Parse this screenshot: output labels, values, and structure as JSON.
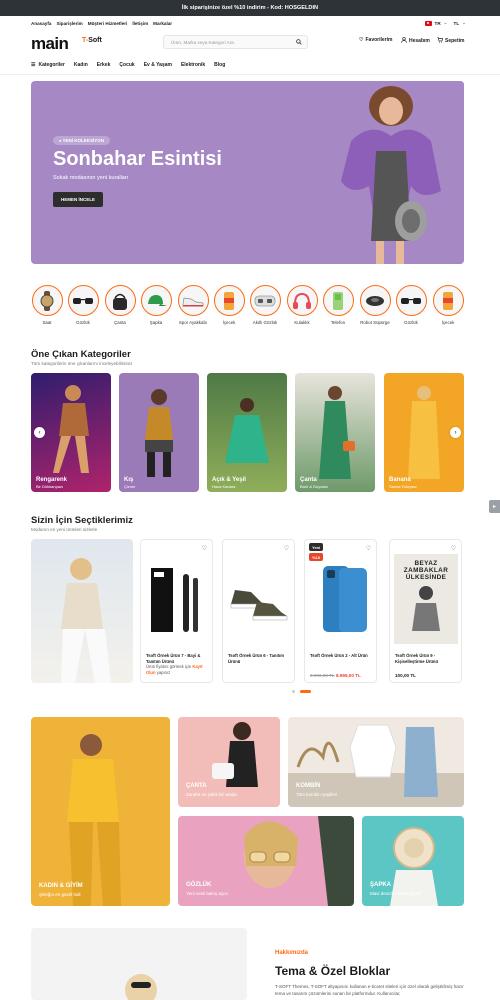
{
  "announcement": "İlk siparişinize özel %10 indirim - Kod: HOSGELDIN",
  "top_links": [
    "Anasayfa",
    "Siparişlerim",
    "Müşteri Hizmetleri",
    "İletişim",
    "Markalar"
  ],
  "language": "TR",
  "currency": "TL",
  "logo": {
    "main": "main",
    "brand_prefix": "T-",
    "brand_suffix": "Soft"
  },
  "search": {
    "placeholder": "Ürün, Marka veya Kategori Ara"
  },
  "header_actions": {
    "favorites": "Favorilerim",
    "account": "Hesabım",
    "cart": "Sepetim"
  },
  "nav": {
    "categories": "Kategoriler",
    "items": [
      "Kadın",
      "Erkek",
      "Çocuk",
      "Ev & Yaşam",
      "Elektronik",
      "Blog"
    ]
  },
  "hero": {
    "badge": "YENİ KOLEKSİYON",
    "title": "Sonbahar Esintisi",
    "subtitle": "Sokak modasının yeni kuralları",
    "button": "HEMEN İNCELE"
  },
  "circle_categories": [
    "Saat",
    "Gözlük",
    "Çanta",
    "Şapka",
    "Spor Ayakkabı",
    "İçecek",
    "Akıllı Gözlük",
    "Kulaklık",
    "Telefon",
    "Robot Süpürge",
    "Gözlük",
    "İçecek"
  ],
  "featured": {
    "title": "Öne Çıkan Kategoriler",
    "subtitle": "Tüm kategorilerin öne çıkanlarını inceleyebilirsiniz",
    "cards": [
      {
        "title": "Rengarenk",
        "subtitle": "Bir Dükkanpazı"
      },
      {
        "title": "Kış",
        "subtitle": "Çizme"
      },
      {
        "title": "Açık & Yeşil",
        "subtitle": "Hava Kadara"
      },
      {
        "title": "Çanta",
        "subtitle": "Barit & Duyulan"
      },
      {
        "title": "Banana",
        "subtitle": "Sarılar Dünyası"
      }
    ]
  },
  "picks": {
    "title": "Sizin İçin Seçtiklerimiz",
    "subtitle": "Modanın en yeni ürünleri sizlerle",
    "products": [
      {
        "name": "Tsoft Örnek Ürün 7 - Bayi & Tanıtım Ürünü",
        "note_prefix": "Ürün fiyatını görmek için",
        "note_link": "Kayıt Olun",
        "note_suffix": "yapınız"
      },
      {
        "name": "Tsoft Örnek Ürün 6 - Tanıtım Ürünü"
      },
      {
        "name": "Tsoft Örnek Ürün 2 - Alt Ürün",
        "old_price": "9.999,00 TL",
        "price": "8.999,00 TL",
        "tag_new": "Yeni",
        "tag_sale": "%10"
      },
      {
        "name": "Tsoft Örnek Ürün 9 - Kişiselleştirme Ürünü",
        "price": "100,00 TL",
        "book_title": "BEYAZ ZAMBAKLAR ÜLKESİNDE"
      }
    ]
  },
  "grid": [
    {
      "title": "KADIN & GİYİM",
      "subtitle": "Şıklığın en güzel hali"
    },
    {
      "title": "ÇANTA",
      "subtitle": "Zarafet ve şıklık bir arada"
    },
    {
      "title": "KOMBİN",
      "subtitle": "Tüm kombin çeşitleri"
    },
    {
      "title": "GÖZLÜK",
      "subtitle": "Yeni nesil bakış açısı"
    },
    {
      "title": "ŞAPKA",
      "subtitle": "Mavi denizler kadar güzel"
    }
  ],
  "about": {
    "kicker": "Hakkımızda",
    "title": "Tema &  Özel Bloklar",
    "text": "T-SOFT Themes, T-SOFT altyapısını kullanan e-ticaret siteleri için özel olarak geliştirilmiş hazır tema ve tasarım çözümlerini sunan bir platformdur. Kullanıcılar,"
  },
  "colors": {
    "accent": "#ff6a13",
    "hero_bg": "#a689c4",
    "topbar": "#2e3338"
  }
}
